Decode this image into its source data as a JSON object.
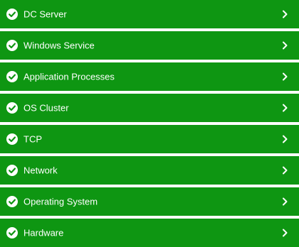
{
  "colors": {
    "row_background": "#0e9612",
    "separator": "#ffffff",
    "text": "#ffffff",
    "status_icon": "#ffffff"
  },
  "items": [
    {
      "label": "DC Server",
      "status_icon": "check-circle-icon",
      "nav_icon": "chevron-right-icon"
    },
    {
      "label": "Windows Service",
      "status_icon": "check-circle-icon",
      "nav_icon": "chevron-right-icon"
    },
    {
      "label": "Application Processes",
      "status_icon": "check-circle-icon",
      "nav_icon": "chevron-right-icon"
    },
    {
      "label": "OS Cluster",
      "status_icon": "check-circle-icon",
      "nav_icon": "chevron-right-icon"
    },
    {
      "label": "TCP",
      "status_icon": "check-circle-icon",
      "nav_icon": "chevron-right-icon"
    },
    {
      "label": "Network",
      "status_icon": "check-circle-icon",
      "nav_icon": "chevron-right-icon"
    },
    {
      "label": "Operating System",
      "status_icon": "check-circle-icon",
      "nav_icon": "chevron-right-icon"
    },
    {
      "label": "Hardware",
      "status_icon": "check-circle-icon",
      "nav_icon": "chevron-right-icon"
    }
  ]
}
